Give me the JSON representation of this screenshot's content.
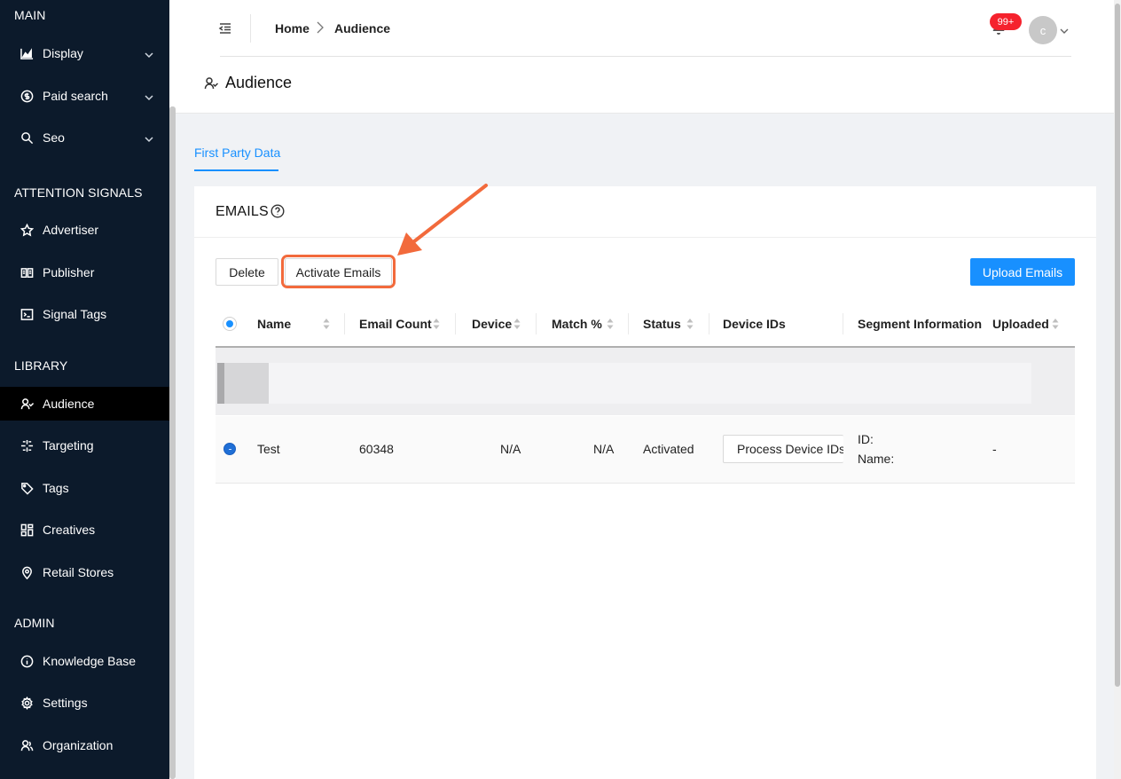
{
  "sidebar": {
    "sections": {
      "main": "MAIN",
      "attention": "ATTENTION SIGNALS",
      "library": "LIBRARY",
      "admin": "ADMIN"
    },
    "items": {
      "display": "Display",
      "paid_search": "Paid search",
      "seo": "Seo",
      "advertiser": "Advertiser",
      "publisher": "Publisher",
      "signal_tags": "Signal Tags",
      "audience": "Audience",
      "targeting": "Targeting",
      "tags": "Tags",
      "creatives": "Creatives",
      "retail_stores": "Retail Stores",
      "knowledge_base": "Knowledge Base",
      "settings": "Settings",
      "organization": "Organization"
    },
    "active_item": "Audience"
  },
  "header": {
    "breadcrumb_home": "Home",
    "breadcrumb_current": "Audience",
    "notification_badge": "99+",
    "avatar_initial": "c"
  },
  "page": {
    "title": "Audience",
    "tab": "First Party Data"
  },
  "card": {
    "title": "EMAILS",
    "buttons": {
      "delete": "Delete",
      "activate": "Activate Emails",
      "upload": "Upload Emails"
    }
  },
  "table": {
    "columns": [
      "Name",
      "Email Count",
      "Device",
      "Match %",
      "Status",
      "Device IDs",
      "Segment Information",
      "Uploaded"
    ],
    "rows": [
      {
        "name": "Test",
        "email_count": "60348",
        "device": "N/A",
        "match": "N/A",
        "status": "Activated",
        "device_ids_button": "Process Device IDs",
        "segment_id_label": "ID:",
        "segment_name_label": "Name:",
        "uploaded": "-"
      }
    ]
  },
  "colors": {
    "sidebar_bg": "#0c1a2b",
    "accent": "#1890ff",
    "highlight": "#f26a3c",
    "badge": "#f5222d"
  }
}
